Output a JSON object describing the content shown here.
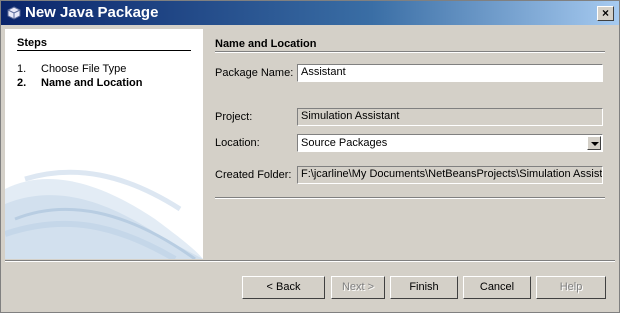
{
  "window": {
    "title": "New Java Package",
    "close_symbol": "×"
  },
  "steps": {
    "title": "Steps",
    "items": [
      {
        "num": "1.",
        "label": "Choose File Type"
      },
      {
        "num": "2.",
        "label": "Name and Location"
      }
    ]
  },
  "section": {
    "title": "Name and Location"
  },
  "form": {
    "package_name_label": "Package Name:",
    "package_name_value": "Assistant",
    "project_label": "Project:",
    "project_value": "Simulation Assistant",
    "location_label": "Location:",
    "location_value": "Source Packages",
    "created_folder_label": "Created Folder:",
    "created_folder_value": "F:\\jcarline\\My Documents\\NetBeansProjects\\Simulation Assistant\\src\\Assistant"
  },
  "buttons": {
    "back": "< Back",
    "next": "Next >",
    "finish": "Finish",
    "cancel": "Cancel",
    "help": "Help"
  },
  "colors": {
    "titlebar": "#0a246a",
    "dialog_bg": "#d4d0c8"
  },
  "icons": {
    "title": "coffee-cup-icon",
    "location_dropdown": "chevron-down-icon"
  }
}
